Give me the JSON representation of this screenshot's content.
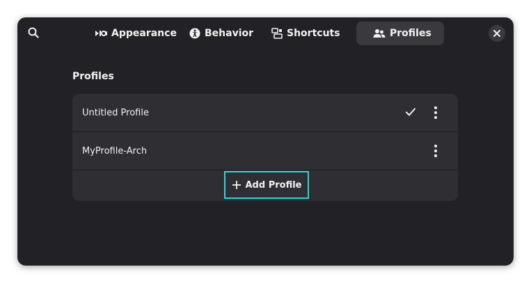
{
  "header": {
    "tabs": [
      {
        "label": "Appearance",
        "icon": "appearance-icon",
        "active": false
      },
      {
        "label": "Behavior",
        "icon": "accessibility-icon",
        "active": false
      },
      {
        "label": "Shortcuts",
        "icon": "shortcuts-icon",
        "active": false
      },
      {
        "label": "Profiles",
        "icon": "profiles-icon",
        "active": true
      }
    ]
  },
  "profiles": {
    "section_title": "Profiles",
    "items": [
      {
        "name": "Untitled Profile",
        "default": true
      },
      {
        "name": "MyProfile-Arch",
        "default": false
      }
    ],
    "add_label": "Add Profile"
  },
  "colors": {
    "window_bg": "#222226",
    "list_bg": "#2f2f33",
    "active_tab_bg": "#3a3a3e",
    "focus_outline": "#2ad6dc"
  }
}
